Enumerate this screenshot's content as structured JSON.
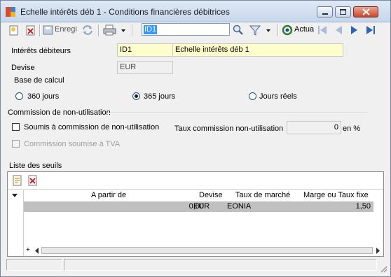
{
  "window": {
    "title": "Echelle intérêts déb 1 -  Conditions financières débitrices"
  },
  "toolbar": {
    "save_label": "Enregi",
    "search_value": "ID1",
    "refresh_label": "Actua"
  },
  "form": {
    "interets_label": "Intérêts débiteurs",
    "interets_code": "ID1",
    "interets_name": "Echelle intérêts déb 1",
    "devise_label": "Devise",
    "devise_value": "EUR",
    "base_label": "Base de calcul",
    "base_options": [
      "360 jours",
      "365 jours",
      "Jours réels"
    ],
    "base_selected": "365 jours",
    "commission_section": "Commission de non-utilisation",
    "soumis_label": "Soumis à commission de non-utilisation",
    "soumis_checked": false,
    "taux_label": "Taux commission non-utilisation",
    "taux_value": "0",
    "taux_unit": "en %",
    "tva_label": "Commission soumise à TVA",
    "tva_checked": false,
    "tva_enabled": false
  },
  "seuils": {
    "section_label": "Liste des seuils",
    "columns": [
      "A partir de",
      "Devise",
      "Taux de marché",
      "Marge ou Taux fixe"
    ],
    "rows": [
      {
        "a_partir_de": "0,00",
        "devise": "EUR",
        "taux_marche": "EONIA",
        "marge": "1,50"
      }
    ],
    "add_symbol": "+"
  },
  "colors": {
    "title_bg": "#c6d6ea",
    "highlight_field": "#fefecc",
    "selected_row": "#c0c0c0",
    "search_selection": "#3399ff"
  }
}
